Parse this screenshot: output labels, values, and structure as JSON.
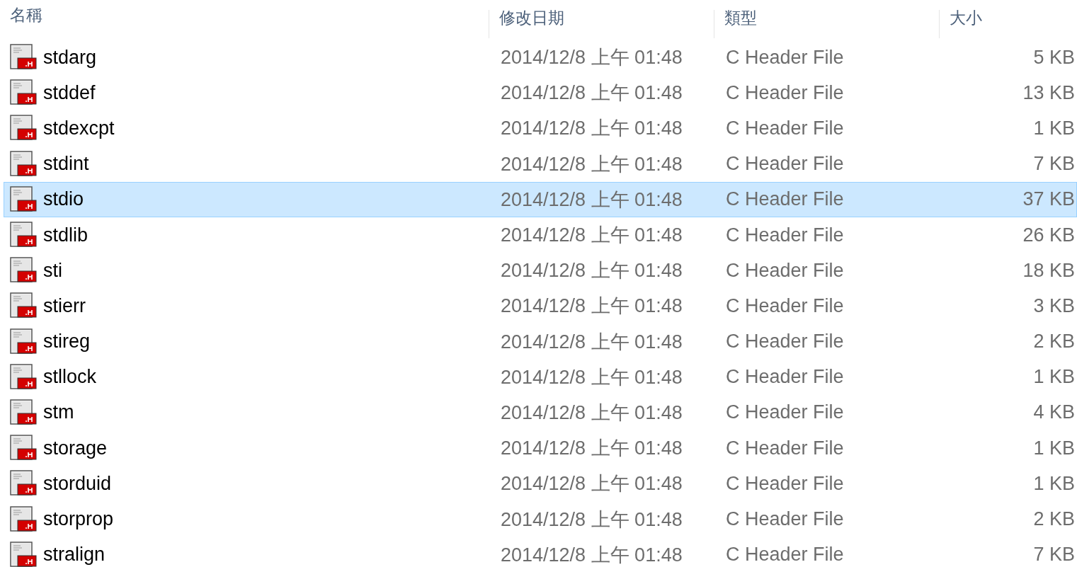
{
  "columns": [
    "名稱",
    "修改日期",
    "類型",
    "大小"
  ],
  "files": [
    {
      "name": "stdarg",
      "modified": "2014/12/8 上午 01:48",
      "type": "C Header File",
      "size": "5 KB",
      "selected": false
    },
    {
      "name": "stddef",
      "modified": "2014/12/8 上午 01:48",
      "type": "C Header File",
      "size": "13 KB",
      "selected": false
    },
    {
      "name": "stdexcpt",
      "modified": "2014/12/8 上午 01:48",
      "type": "C Header File",
      "size": "1 KB",
      "selected": false
    },
    {
      "name": "stdint",
      "modified": "2014/12/8 上午 01:48",
      "type": "C Header File",
      "size": "7 KB",
      "selected": false
    },
    {
      "name": "stdio",
      "modified": "2014/12/8 上午 01:48",
      "type": "C Header File",
      "size": "37 KB",
      "selected": true
    },
    {
      "name": "stdlib",
      "modified": "2014/12/8 上午 01:48",
      "type": "C Header File",
      "size": "26 KB",
      "selected": false
    },
    {
      "name": "sti",
      "modified": "2014/12/8 上午 01:48",
      "type": "C Header File",
      "size": "18 KB",
      "selected": false
    },
    {
      "name": "stierr",
      "modified": "2014/12/8 上午 01:48",
      "type": "C Header File",
      "size": "3 KB",
      "selected": false
    },
    {
      "name": "stireg",
      "modified": "2014/12/8 上午 01:48",
      "type": "C Header File",
      "size": "2 KB",
      "selected": false
    },
    {
      "name": "stllock",
      "modified": "2014/12/8 上午 01:48",
      "type": "C Header File",
      "size": "1 KB",
      "selected": false
    },
    {
      "name": "stm",
      "modified": "2014/12/8 上午 01:48",
      "type": "C Header File",
      "size": "4 KB",
      "selected": false
    },
    {
      "name": "storage",
      "modified": "2014/12/8 上午 01:48",
      "type": "C Header File",
      "size": "1 KB",
      "selected": false
    },
    {
      "name": "storduid",
      "modified": "2014/12/8 上午 01:48",
      "type": "C Header File",
      "size": "1 KB",
      "selected": false
    },
    {
      "name": "storprop",
      "modified": "2014/12/8 上午 01:48",
      "type": "C Header File",
      "size": "2 KB",
      "selected": false
    },
    {
      "name": "stralign",
      "modified": "2014/12/8 上午 01:48",
      "type": "C Header File",
      "size": "7 KB",
      "selected": false
    }
  ]
}
